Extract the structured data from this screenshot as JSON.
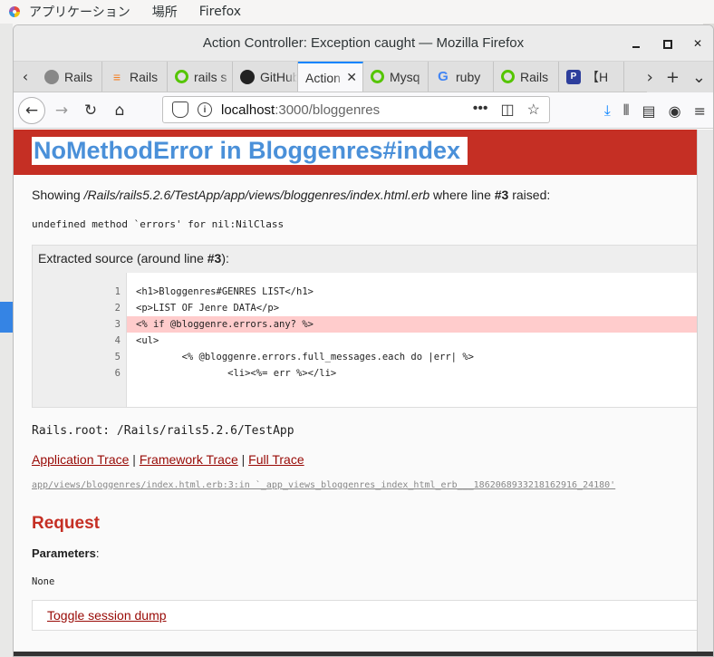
{
  "topbar": {
    "applications": "アプリケーション",
    "places": "場所",
    "app": "Firefox"
  },
  "window": {
    "title": "Action Controller: Exception caught — Mozilla Firefox"
  },
  "tabs": [
    {
      "label": "Rails",
      "icon": "rails-icon"
    },
    {
      "label": "Rails",
      "icon": "stackoverflow-icon"
    },
    {
      "label": "rails s",
      "icon": "qiita-icon"
    },
    {
      "label": "GitHub",
      "icon": "github-icon"
    },
    {
      "label": "Action",
      "icon": "none",
      "active": true
    },
    {
      "label": "Mysq",
      "icon": "qiita-icon"
    },
    {
      "label": "ruby",
      "icon": "google-icon"
    },
    {
      "label": "Rails",
      "icon": "qiita-icon"
    },
    {
      "label": "【H",
      "icon": "pp-icon"
    }
  ],
  "url": {
    "host": "localhost",
    "path": ":3000/bloggenres"
  },
  "page": {
    "heading": "NoMethodError in Bloggenres#index",
    "showing_prefix": "Showing ",
    "showing_path": "/Rails/rails5.2.6/TestApp/app/views/bloggenres/index.html.erb",
    "showing_mid": " where line ",
    "showing_line": "#3",
    "showing_suffix": " raised:",
    "error_message": "undefined method `errors' for nil:NilClass",
    "extracted_prefix": "Extracted source (around line ",
    "extracted_line": "#3",
    "extracted_suffix": "):",
    "line_numbers": [
      "1",
      "2",
      "3",
      "4",
      "5",
      "6"
    ],
    "code_lines": [
      "<h1>Bloggenres#GENRES LIST</h1>",
      "<p>LIST OF Jenre DATA</p>",
      "<% if @bloggenre.errors.any? %>",
      "<ul>",
      "        <% @bloggenre.errors.full_messages.each do |err| %>",
      "                <li><%= err %></li>"
    ],
    "rails_root": "Rails.root: /Rails/rails5.2.6/TestApp",
    "trace_links": [
      "Application Trace",
      "Framework Trace",
      "Full Trace"
    ],
    "trace_separator": " | ",
    "trace_line": "app/views/bloggenres/index.html.erb:3:in `_app_views_bloggenres_index_html_erb___1862068933218162916_24180'",
    "request_heading": "Request",
    "parameters_label": "Parameters",
    "parameters_colon": ":",
    "parameters_value": "None",
    "toggle_session": "Toggle session dump"
  },
  "colors": {
    "error_red": "#c52f24",
    "heading_blue": "#4a90d9",
    "link_red": "#980905",
    "highlight": "#ffcccc"
  }
}
